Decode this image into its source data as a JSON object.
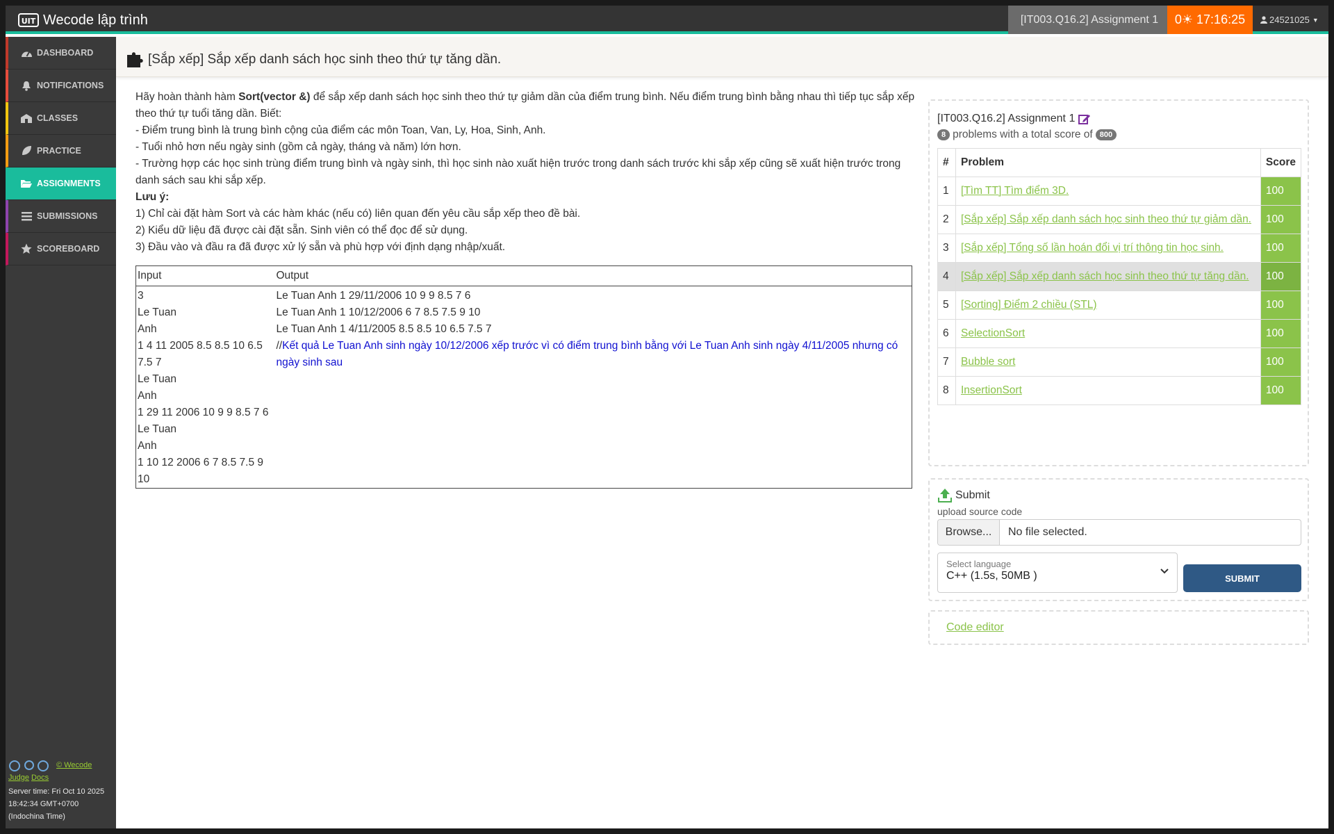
{
  "topbar": {
    "brand": "Wecode lập trình",
    "assignment": "[IT003.Q16.2] Assignment 1",
    "timer": "0☀ 17:16:25",
    "user": "24521025"
  },
  "sidebar": {
    "items": [
      {
        "label": "DASHBOARD",
        "icon": "dashboard-icon",
        "color": "#c0392b"
      },
      {
        "label": "NOTIFICATIONS",
        "icon": "bell-icon",
        "color": "#e74c3c"
      },
      {
        "label": "CLASSES",
        "icon": "school-icon",
        "color": "#f1c40f"
      },
      {
        "label": "PRACTICE",
        "icon": "leaf-icon",
        "color": "#f39c12"
      },
      {
        "label": "ASSIGNMENTS",
        "icon": "folder-open-icon",
        "color": "#1abc9c"
      },
      {
        "label": "SUBMISSIONS",
        "icon": "list-icon",
        "color": "#8e44ad"
      },
      {
        "label": "SCOREBOARD",
        "icon": "star-icon",
        "color": "#c2185b"
      }
    ],
    "footer": {
      "copyright": "© Wecode",
      "judge": "Judge",
      "docs": "Docs",
      "server_time": "Server time: Fri Oct 10 2025 18:42:34 GMT+0700 (Indochina Time)"
    }
  },
  "header": {
    "title": "[Sắp xếp] Sắp xếp danh sách học sinh theo thứ tự tăng dần."
  },
  "problem": {
    "intro_pre": "Hãy hoàn thành hàm ",
    "intro_bold": "Sort(vector &)",
    "intro_post": " để sắp xếp danh sách học sinh theo thứ tự giảm dần của điểm trung bình. Nếu điểm trung bình bằng nhau thì tiếp tục sắp xếp theo thứ tự tuổi tăng dần. Biết:",
    "bullets": [
      "- Điểm trung bình là trung bình cộng của điểm các môn Toan, Van, Ly, Hoa, Sinh, Anh.",
      "- Tuổi nhỏ hơn nếu ngày sinh (gồm cả ngày, tháng và năm) lớn hơn.",
      "- Trường hợp các học sinh trùng điểm trung bình và ngày sinh, thì học sinh nào xuất hiện trước trong danh sách trước khi sắp xếp cũng sẽ xuất hiện trước trong danh sách sau khi sắp xếp."
    ],
    "note_title": "Lưu ý:",
    "notes": [
      "1) Chỉ cài đặt hàm Sort và các hàm khác (nếu có) liên quan đến yêu cầu sắp xếp theo đề bài.",
      "2) Kiểu dữ liệu đã được cài đặt sẵn. Sinh viên có thể đọc để sử dụng.",
      "3) Đầu vào và đầu ra đã được xử lý sẵn và phù hợp với định dạng nhập/xuất."
    ],
    "io": {
      "input_header": "Input",
      "output_header": "Output",
      "input_lines": [
        "3",
        "Le Tuan",
        "Anh",
        "1 4 11 2005 8.5 8.5 10 6.5",
        "7.5 7",
        "Le Tuan",
        "Anh",
        "1 29 11 2006 10 9 9 8.5 7 6",
        "Le Tuan",
        "Anh",
        "1 10 12 2006 6 7 8.5 7.5 9",
        "10"
      ],
      "output_lines": [
        "Le Tuan Anh 1 29/11/2006 10 9 9 8.5 7 6",
        "Le Tuan Anh 1 10/12/2006 6 7 8.5 7.5 9 10",
        "Le Tuan Anh 1 4/11/2005 8.5 8.5 10 6.5 7.5 7"
      ],
      "comment_prefix": "//",
      "comment": "Kết quả Le Tuan Anh sinh ngày 10/12/2006 xếp trước vì có điểm trung bình bằng với Le Tuan Anh sinh ngày 4/11/2005 nhưng có ngày sinh sau"
    }
  },
  "assignment": {
    "title": "[IT003.Q16.2] Assignment 1",
    "count": "8",
    "summary_text": "problems with a total score of",
    "total": "800",
    "col_num": "#",
    "col_problem": "Problem",
    "col_score": "Score",
    "problems": [
      {
        "num": "1",
        "name": "[Tìm TT] Tìm điểm 3D.",
        "score": "100"
      },
      {
        "num": "2",
        "name": "[Sắp xếp] Sắp xếp danh sách học sinh theo thứ tự giảm dần.",
        "score": "100"
      },
      {
        "num": "3",
        "name": "[Sắp xếp] Tổng số lần hoán đổi vị trí thông tin học sinh.",
        "score": "100"
      },
      {
        "num": "4",
        "name": "[Sắp xếp] Sắp xếp danh sách học sinh theo thứ tự tăng dần.",
        "score": "100"
      },
      {
        "num": "5",
        "name": "[Sorting] Điểm 2 chiều (STL)",
        "score": "100"
      },
      {
        "num": "6",
        "name": "SelectionSort",
        "score": "100"
      },
      {
        "num": "7",
        "name": "Bubble sort",
        "score": "100"
      },
      {
        "num": "8",
        "name": "InsertionSort",
        "score": "100"
      }
    ],
    "selected_index": 3
  },
  "submit": {
    "title": "Submit",
    "upload_label": "upload source code",
    "browse": "Browse...",
    "no_file": "No file selected.",
    "lang_label": "Select language",
    "lang_value": "C++ (1.5s, 50MB )",
    "button": "SUBMIT"
  },
  "editor": {
    "link": "Code editor"
  },
  "colors": {
    "accent": "#1abc9c",
    "timer": "#ff6a00",
    "score": "#8bc34a",
    "submit_button": "#2f5985"
  }
}
